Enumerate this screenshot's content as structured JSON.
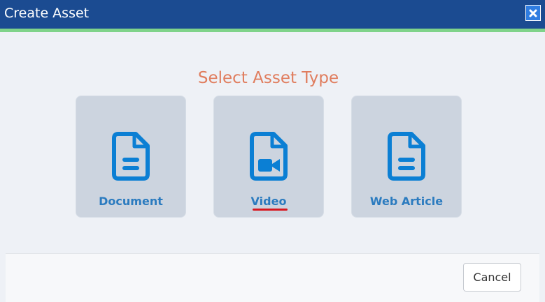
{
  "dialog": {
    "title": "Create Asset",
    "close_icon": "close-icon"
  },
  "heading": "Select Asset Type",
  "asset_types": [
    {
      "label": "Document",
      "icon": "document-icon"
    },
    {
      "label": "Video",
      "icon": "video-file-icon"
    },
    {
      "label": "Web Article",
      "icon": "document-icon"
    }
  ],
  "footer": {
    "cancel_label": "Cancel"
  },
  "colors": {
    "titlebar": "#1b4b91",
    "accent": "#7fd38a",
    "heading": "#e07d5e",
    "card_bg": "#ccd4df",
    "card_text": "#2b7bbf",
    "underline": "#d8161f"
  }
}
